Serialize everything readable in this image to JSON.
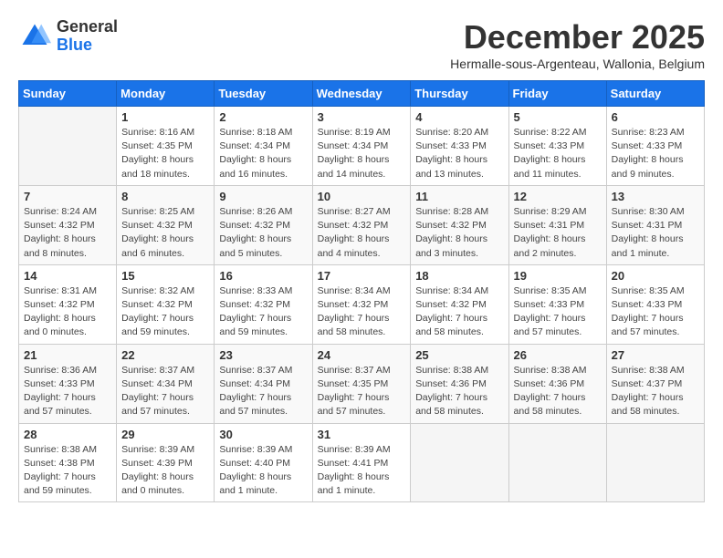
{
  "header": {
    "logo_general": "General",
    "logo_blue": "Blue",
    "month_title": "December 2025",
    "subtitle": "Hermalle-sous-Argenteau, Wallonia, Belgium"
  },
  "weekdays": [
    "Sunday",
    "Monday",
    "Tuesday",
    "Wednesday",
    "Thursday",
    "Friday",
    "Saturday"
  ],
  "weeks": [
    [
      {
        "day": "",
        "info": ""
      },
      {
        "day": "1",
        "info": "Sunrise: 8:16 AM\nSunset: 4:35 PM\nDaylight: 8 hours\nand 18 minutes."
      },
      {
        "day": "2",
        "info": "Sunrise: 8:18 AM\nSunset: 4:34 PM\nDaylight: 8 hours\nand 16 minutes."
      },
      {
        "day": "3",
        "info": "Sunrise: 8:19 AM\nSunset: 4:34 PM\nDaylight: 8 hours\nand 14 minutes."
      },
      {
        "day": "4",
        "info": "Sunrise: 8:20 AM\nSunset: 4:33 PM\nDaylight: 8 hours\nand 13 minutes."
      },
      {
        "day": "5",
        "info": "Sunrise: 8:22 AM\nSunset: 4:33 PM\nDaylight: 8 hours\nand 11 minutes."
      },
      {
        "day": "6",
        "info": "Sunrise: 8:23 AM\nSunset: 4:33 PM\nDaylight: 8 hours\nand 9 minutes."
      }
    ],
    [
      {
        "day": "7",
        "info": "Sunrise: 8:24 AM\nSunset: 4:32 PM\nDaylight: 8 hours\nand 8 minutes."
      },
      {
        "day": "8",
        "info": "Sunrise: 8:25 AM\nSunset: 4:32 PM\nDaylight: 8 hours\nand 6 minutes."
      },
      {
        "day": "9",
        "info": "Sunrise: 8:26 AM\nSunset: 4:32 PM\nDaylight: 8 hours\nand 5 minutes."
      },
      {
        "day": "10",
        "info": "Sunrise: 8:27 AM\nSunset: 4:32 PM\nDaylight: 8 hours\nand 4 minutes."
      },
      {
        "day": "11",
        "info": "Sunrise: 8:28 AM\nSunset: 4:32 PM\nDaylight: 8 hours\nand 3 minutes."
      },
      {
        "day": "12",
        "info": "Sunrise: 8:29 AM\nSunset: 4:31 PM\nDaylight: 8 hours\nand 2 minutes."
      },
      {
        "day": "13",
        "info": "Sunrise: 8:30 AM\nSunset: 4:31 PM\nDaylight: 8 hours\nand 1 minute."
      }
    ],
    [
      {
        "day": "14",
        "info": "Sunrise: 8:31 AM\nSunset: 4:32 PM\nDaylight: 8 hours\nand 0 minutes."
      },
      {
        "day": "15",
        "info": "Sunrise: 8:32 AM\nSunset: 4:32 PM\nDaylight: 7 hours\nand 59 minutes."
      },
      {
        "day": "16",
        "info": "Sunrise: 8:33 AM\nSunset: 4:32 PM\nDaylight: 7 hours\nand 59 minutes."
      },
      {
        "day": "17",
        "info": "Sunrise: 8:34 AM\nSunset: 4:32 PM\nDaylight: 7 hours\nand 58 minutes."
      },
      {
        "day": "18",
        "info": "Sunrise: 8:34 AM\nSunset: 4:32 PM\nDaylight: 7 hours\nand 58 minutes."
      },
      {
        "day": "19",
        "info": "Sunrise: 8:35 AM\nSunset: 4:33 PM\nDaylight: 7 hours\nand 57 minutes."
      },
      {
        "day": "20",
        "info": "Sunrise: 8:35 AM\nSunset: 4:33 PM\nDaylight: 7 hours\nand 57 minutes."
      }
    ],
    [
      {
        "day": "21",
        "info": "Sunrise: 8:36 AM\nSunset: 4:33 PM\nDaylight: 7 hours\nand 57 minutes."
      },
      {
        "day": "22",
        "info": "Sunrise: 8:37 AM\nSunset: 4:34 PM\nDaylight: 7 hours\nand 57 minutes."
      },
      {
        "day": "23",
        "info": "Sunrise: 8:37 AM\nSunset: 4:34 PM\nDaylight: 7 hours\nand 57 minutes."
      },
      {
        "day": "24",
        "info": "Sunrise: 8:37 AM\nSunset: 4:35 PM\nDaylight: 7 hours\nand 57 minutes."
      },
      {
        "day": "25",
        "info": "Sunrise: 8:38 AM\nSunset: 4:36 PM\nDaylight: 7 hours\nand 58 minutes."
      },
      {
        "day": "26",
        "info": "Sunrise: 8:38 AM\nSunset: 4:36 PM\nDaylight: 7 hours\nand 58 minutes."
      },
      {
        "day": "27",
        "info": "Sunrise: 8:38 AM\nSunset: 4:37 PM\nDaylight: 7 hours\nand 58 minutes."
      }
    ],
    [
      {
        "day": "28",
        "info": "Sunrise: 8:38 AM\nSunset: 4:38 PM\nDaylight: 7 hours\nand 59 minutes."
      },
      {
        "day": "29",
        "info": "Sunrise: 8:39 AM\nSunset: 4:39 PM\nDaylight: 8 hours\nand 0 minutes."
      },
      {
        "day": "30",
        "info": "Sunrise: 8:39 AM\nSunset: 4:40 PM\nDaylight: 8 hours\nand 1 minute."
      },
      {
        "day": "31",
        "info": "Sunrise: 8:39 AM\nSunset: 4:41 PM\nDaylight: 8 hours\nand 1 minute."
      },
      {
        "day": "",
        "info": ""
      },
      {
        "day": "",
        "info": ""
      },
      {
        "day": "",
        "info": ""
      }
    ]
  ]
}
